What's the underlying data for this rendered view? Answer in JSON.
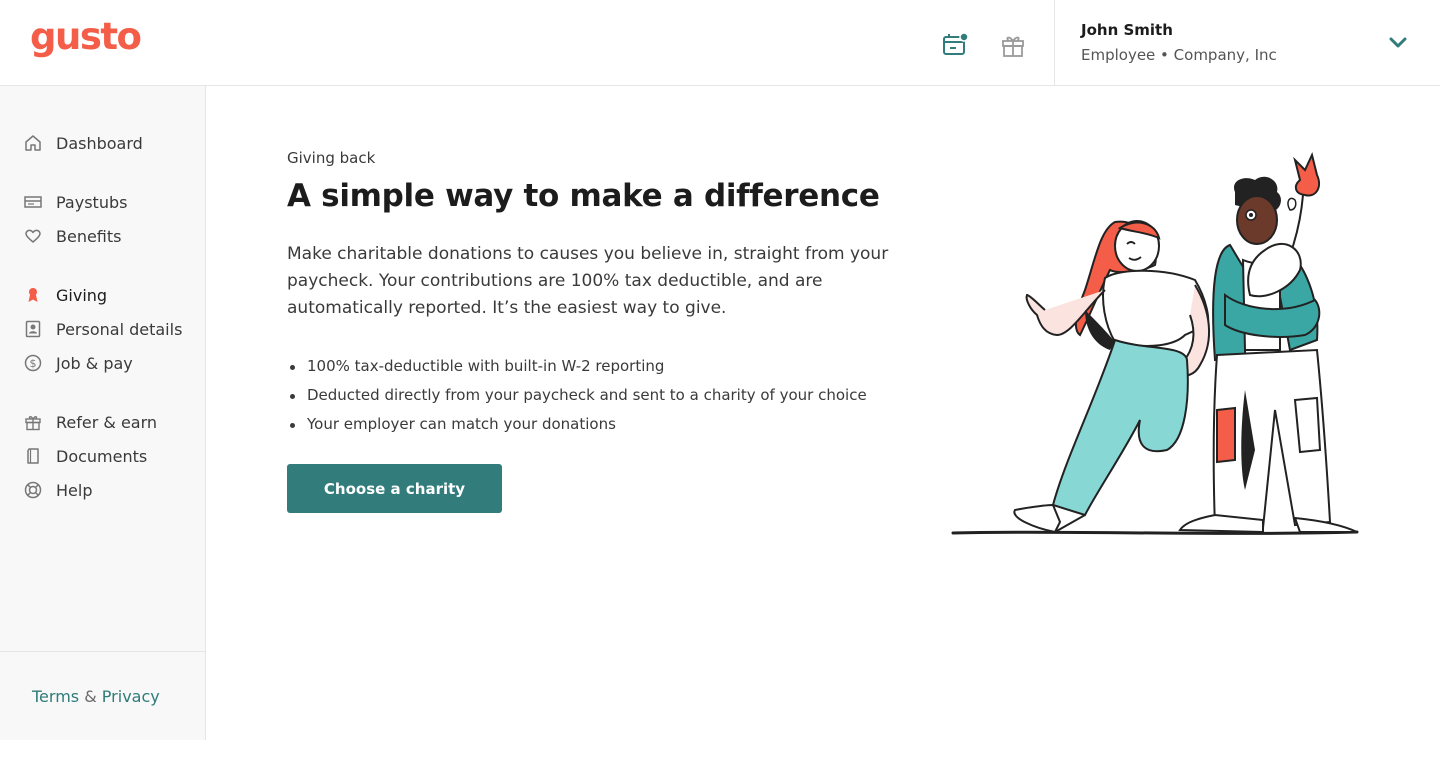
{
  "brand": {
    "logo_text": "gusto",
    "primary_color": "#f45d48",
    "accent_color": "#327d7c"
  },
  "header": {
    "icons": [
      "calendar-notification-icon",
      "gift-icon"
    ],
    "user_name": "John Smith",
    "user_role": "Employee • Company, Inc"
  },
  "sidebar": {
    "items": [
      {
        "label": "Dashboard",
        "icon": "home-icon"
      },
      {
        "label": "Paystubs",
        "icon": "paystub-icon"
      },
      {
        "label": "Benefits",
        "icon": "heart-icon"
      },
      {
        "label": "Giving",
        "icon": "giving-ribbon-icon",
        "active": true
      },
      {
        "label": "Personal details",
        "icon": "person-card-icon"
      },
      {
        "label": "Job & pay",
        "icon": "dollar-circle-icon"
      },
      {
        "label": "Refer & earn",
        "icon": "gift-icon"
      },
      {
        "label": "Documents",
        "icon": "document-icon"
      },
      {
        "label": "Help",
        "icon": "lifebuoy-icon"
      }
    ],
    "footer": {
      "terms": "Terms",
      "amp": "&",
      "privacy": "Privacy"
    }
  },
  "main": {
    "eyebrow": "Giving back",
    "headline": "A simple way to make a difference",
    "description": "Make charitable donations to causes you believe in, straight from your paycheck. Your contributions are 100% tax deductible, and are automatically reported. It’s the easiest way to give.",
    "bullets": [
      "100% tax-deductible with built-in W-2 reporting",
      "Deducted directly from your paycheck and sent to a charity of your choice",
      "Your employer can match your donations"
    ],
    "cta_label": "Choose a charity"
  }
}
